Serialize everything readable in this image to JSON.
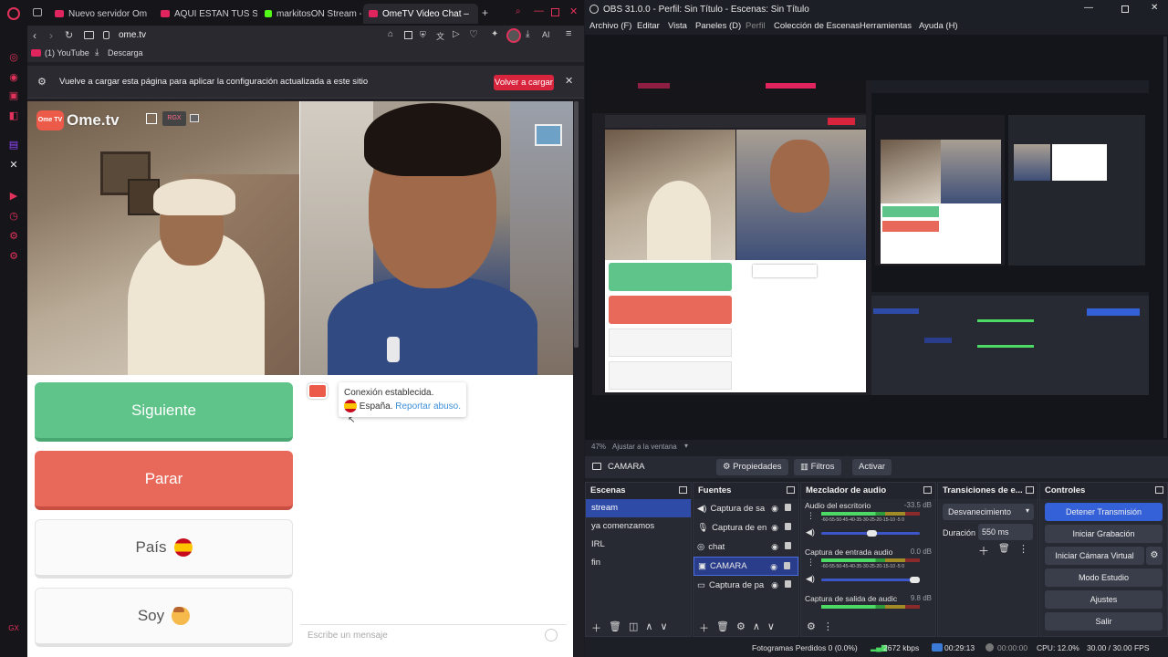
{
  "browser": {
    "tabs": [
      {
        "label": "Nuevo servidor Om",
        "color": "#e0245e"
      },
      {
        "label": "AQUI ESTAN TUS SUE",
        "color": "#e0245e"
      },
      {
        "label": "markitosON Stream -",
        "color": "#53fc18"
      },
      {
        "label": "OmeTV Video Chat –",
        "color": "#e0245e",
        "active": true
      }
    ],
    "url": "ome.tv",
    "bookmarks": [
      "(1) YouTube",
      "Descarga"
    ],
    "ai_label": "AI",
    "infobar": {
      "message": "Vuelve a cargar esta página para aplicar la configuración actualizada a este sitio",
      "reload_button": "Volver a cargar"
    }
  },
  "ometv": {
    "logo_bubble": "Ome TV",
    "logo_text": "Ome.tv",
    "rgx_label": "RGX",
    "buttons": {
      "next": "Siguiente",
      "stop": "Parar",
      "country": "País",
      "me": "Soy"
    },
    "chat": {
      "status": "Conexión establecida.",
      "country": "España.",
      "report": "Reportar abuso.",
      "placeholder": "Escribe un mensaje"
    },
    "colors": {
      "next": "#5fc48a",
      "stop": "#e8685a",
      "link": "#3b8fd9"
    }
  },
  "obs": {
    "title": "OBS 31.0.0 - Perfil: Sin Título - Escenas: Sin Título",
    "menu": [
      "Archivo (F)",
      "Editar",
      "Vista",
      "Paneles (D)",
      "Perfil",
      "Colección de Escenas",
      "Herramientas",
      "Ayuda (H)"
    ],
    "zoom": "47%",
    "fit_label": "Ajustar a la ventana",
    "source_toolbar": {
      "source_name": "CAMARA",
      "properties": "Propiedades",
      "filters": "Filtros",
      "activate": "Activar"
    },
    "docks": {
      "scenes": "Escenas",
      "sources": "Fuentes",
      "mixer": "Mezclador de audio",
      "transitions": "Transiciones de e...",
      "controls": "Controles"
    },
    "scenes": [
      "stream",
      "ya comenzamos",
      "IRL",
      "fin"
    ],
    "sources": [
      "Captura de sa",
      "Captura de en",
      "chat",
      "CAMARA",
      "Captura de pa"
    ],
    "mixer": [
      {
        "name": "Audio del escritorio",
        "db": "-33.5 dB"
      },
      {
        "name": "Captura de entrada audio",
        "db": "0.0 dB"
      },
      {
        "name": "Captura de salida de audic",
        "db": "9.8 dB"
      }
    ],
    "mixer_scale": "-60-55-50-45-40-35-30-25-20-15-10 -5 0",
    "transitions": {
      "type": "Desvanecimiento",
      "duration_label": "Duración",
      "duration": "550 ms"
    },
    "controls": [
      "Detener Transmisión",
      "Iniciar Grabación",
      "Iniciar Cámara Virtual",
      "Modo Estudio",
      "Ajustes",
      "Salir"
    ],
    "status": {
      "dropped": "Fotogramas Perdidos 0 (0.0%)",
      "bitrate": "2672 kbps",
      "stream_time": "00:29:13",
      "rec_time": "00:00:00",
      "cpu": "CPU: 12.0%",
      "fps": "30.00 / 30.00 FPS"
    }
  }
}
